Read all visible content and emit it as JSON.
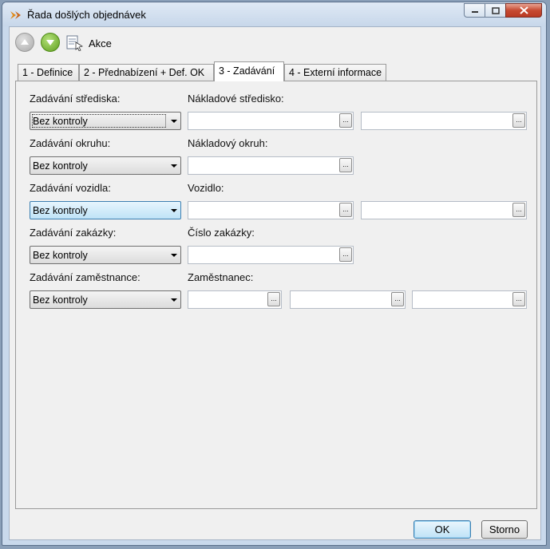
{
  "window": {
    "title": "Řada došlých objednávek"
  },
  "toolbar": {
    "akce_label": "Akce"
  },
  "tabs": [
    {
      "label": "1 - Definice"
    },
    {
      "label": "2 - Přednabízení + Def. OK"
    },
    {
      "label": "3 - Zadávání",
      "active": true
    },
    {
      "label": "4 - Externí informace"
    }
  ],
  "rows": [
    {
      "mode_label": "Zadávání střediska:",
      "mode_value": "Bez kontroly",
      "target_label": "Nákladové středisko:"
    },
    {
      "mode_label": "Zadávání okruhu:",
      "mode_value": "Bez kontroly",
      "target_label": "Nákladový okruh:"
    },
    {
      "mode_label": "Zadávání vozidla:",
      "mode_value": "Bez kontroly",
      "target_label": "Vozidlo:"
    },
    {
      "mode_label": "Zadávání zakázky:",
      "mode_value": "Bez kontroly",
      "target_label": "Číslo zakázky:"
    },
    {
      "mode_label": "Zadávání zaměstnance:",
      "mode_value": "Bez kontroly",
      "target_label": "Zaměstnanec:"
    }
  ],
  "ellipsis_label": "...",
  "footer": {
    "ok_label": "OK",
    "cancel_label": "Storno"
  }
}
